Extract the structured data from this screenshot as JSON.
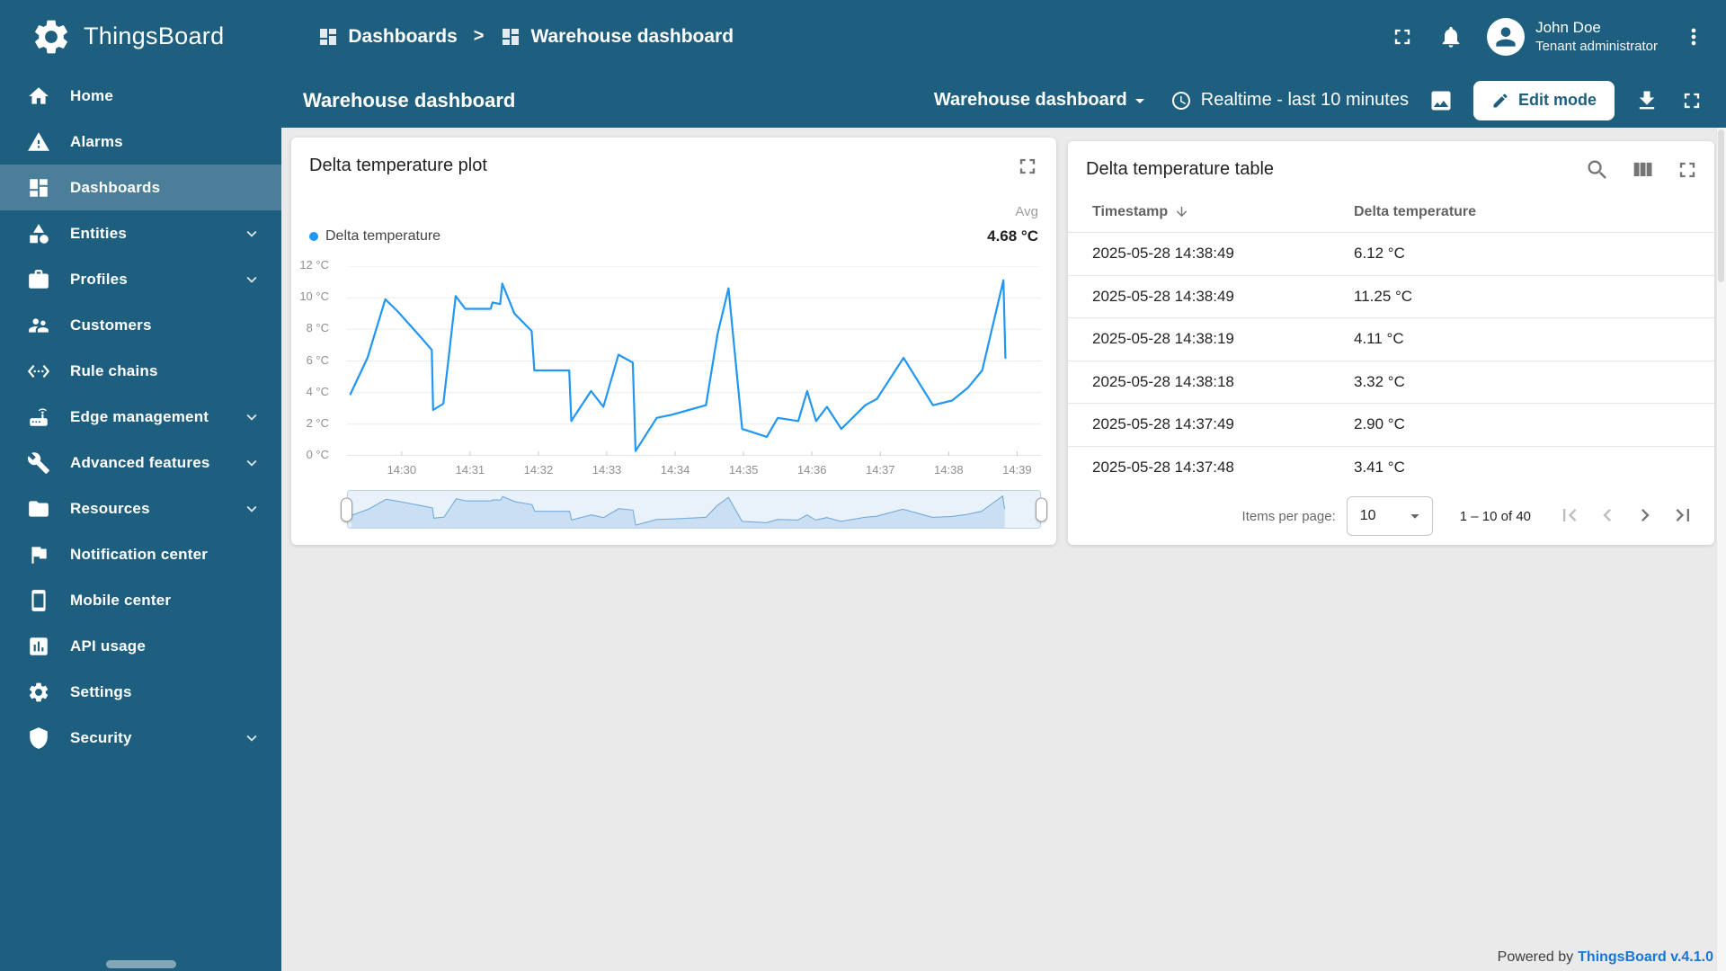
{
  "colors": {
    "primary": "#1e5f80",
    "sidebar_active": "rgba(255,255,255,0.2)",
    "chart_line": "#2196f3",
    "link_blue": "#1976d2",
    "content_bg": "#eaeaea"
  },
  "header": {
    "app_name": "ThingsBoard",
    "breadcrumb": [
      {
        "label": "Dashboards"
      },
      {
        "label": "Warehouse dashboard"
      }
    ],
    "breadcrumb_separator": ">",
    "user": {
      "name": "John Doe",
      "role": "Tenant administrator"
    }
  },
  "sidebar": {
    "items": [
      {
        "label": "Home",
        "icon": "home",
        "active": false,
        "expandable": false
      },
      {
        "label": "Alarms",
        "icon": "alarms",
        "active": false,
        "expandable": false
      },
      {
        "label": "Dashboards",
        "icon": "dashboards",
        "active": true,
        "expandable": false
      },
      {
        "label": "Entities",
        "icon": "entities",
        "active": false,
        "expandable": true
      },
      {
        "label": "Profiles",
        "icon": "profiles",
        "active": false,
        "expandable": true
      },
      {
        "label": "Customers",
        "icon": "customers",
        "active": false,
        "expandable": false
      },
      {
        "label": "Rule chains",
        "icon": "rule-chains",
        "active": false,
        "expandable": false
      },
      {
        "label": "Edge management",
        "icon": "edge-management",
        "active": false,
        "expandable": true
      },
      {
        "label": "Advanced features",
        "icon": "advanced-features",
        "active": false,
        "expandable": true
      },
      {
        "label": "Resources",
        "icon": "resources",
        "active": false,
        "expandable": true
      },
      {
        "label": "Notification center",
        "icon": "notification-center",
        "active": false,
        "expandable": false
      },
      {
        "label": "Mobile center",
        "icon": "mobile-center",
        "active": false,
        "expandable": false
      },
      {
        "label": "API usage",
        "icon": "api-usage",
        "active": false,
        "expandable": false
      },
      {
        "label": "Settings",
        "icon": "settings",
        "active": false,
        "expandable": false
      },
      {
        "label": "Security",
        "icon": "security",
        "active": false,
        "expandable": true
      }
    ]
  },
  "toolbar": {
    "title": "Warehouse dashboard",
    "state_selector": "Warehouse dashboard",
    "timewindow": "Realtime - last 10 minutes",
    "edit_button": "Edit mode"
  },
  "plot_widget": {
    "title": "Delta temperature plot",
    "agg_label": "Avg",
    "series_label": "Delta temperature",
    "agg_value": "4.68 °C"
  },
  "table_widget": {
    "title": "Delta temperature table",
    "columns": [
      "Timestamp",
      "Delta temperature"
    ],
    "rows": [
      {
        "timestamp": "2025-05-28 14:38:49",
        "value": "6.12 °C"
      },
      {
        "timestamp": "2025-05-28 14:38:49",
        "value": "11.25 °C"
      },
      {
        "timestamp": "2025-05-28 14:38:19",
        "value": "4.11 °C"
      },
      {
        "timestamp": "2025-05-28 14:38:18",
        "value": "3.32 °C"
      },
      {
        "timestamp": "2025-05-28 14:37:49",
        "value": "2.90 °C"
      },
      {
        "timestamp": "2025-05-28 14:37:48",
        "value": "3.41 °C"
      }
    ],
    "pagination": {
      "items_per_page_label": "Items per page:",
      "items_per_page": "10",
      "range": "1 – 10 of 40"
    }
  },
  "footer": {
    "powered_by": "Powered by",
    "link": "ThingsBoard v.4.1.0"
  },
  "chart_data": {
    "type": "line",
    "title": "Delta temperature plot",
    "x_unit": "minutes after 14:30",
    "y_unit": "°C",
    "xlim": [
      -0.8,
      9.35
    ],
    "ylim": [
      0,
      12
    ],
    "grid": "horizontal",
    "legend_position": "top-left",
    "avg": {
      "label": "Avg",
      "value": "4.68 °C"
    },
    "xticks": [
      {
        "value": 0,
        "label": "14:30"
      },
      {
        "value": 1,
        "label": "14:31"
      },
      {
        "value": 2,
        "label": "14:32"
      },
      {
        "value": 3,
        "label": "14:33"
      },
      {
        "value": 4,
        "label": "14:34"
      },
      {
        "value": 5,
        "label": "14:35"
      },
      {
        "value": 6,
        "label": "14:36"
      },
      {
        "value": 7,
        "label": "14:37"
      },
      {
        "value": 8,
        "label": "14:38"
      },
      {
        "value": 9,
        "label": "14:39"
      }
    ],
    "yticks": [
      {
        "value": 0,
        "label": "0 °C"
      },
      {
        "value": 2,
        "label": "2 °C"
      },
      {
        "value": 4,
        "label": "4 °C"
      },
      {
        "value": 6,
        "label": "6 °C"
      },
      {
        "value": 8,
        "label": "8 °C"
      },
      {
        "value": 10,
        "label": "10 °C"
      },
      {
        "value": 12,
        "label": "12 °C"
      }
    ],
    "series": [
      {
        "name": "Delta temperature",
        "color": "#2196f3",
        "points": [
          [
            -0.75,
            3.9
          ],
          [
            -0.5,
            6.2
          ],
          [
            -0.24,
            9.9
          ],
          [
            -0.05,
            9.1
          ],
          [
            0.3,
            7.4
          ],
          [
            0.44,
            6.7
          ],
          [
            0.46,
            2.9
          ],
          [
            0.61,
            3.3
          ],
          [
            0.79,
            10.1
          ],
          [
            0.93,
            9.3
          ],
          [
            1.3,
            9.3
          ],
          [
            1.33,
            9.7
          ],
          [
            1.44,
            9.6
          ],
          [
            1.47,
            10.9
          ],
          [
            1.65,
            9.0
          ],
          [
            1.9,
            7.9
          ],
          [
            1.94,
            5.4
          ],
          [
            2.45,
            5.4
          ],
          [
            2.48,
            2.2
          ],
          [
            2.77,
            4.1
          ],
          [
            2.95,
            3.1
          ],
          [
            3.17,
            6.4
          ],
          [
            3.38,
            5.9
          ],
          [
            3.42,
            0.3
          ],
          [
            3.73,
            2.4
          ],
          [
            3.95,
            2.6
          ],
          [
            4.45,
            3.2
          ],
          [
            4.62,
            7.7
          ],
          [
            4.78,
            10.6
          ],
          [
            4.98,
            1.7
          ],
          [
            5.34,
            1.2
          ],
          [
            5.5,
            2.4
          ],
          [
            5.8,
            2.2
          ],
          [
            5.93,
            4.1
          ],
          [
            6.06,
            2.2
          ],
          [
            6.22,
            3.1
          ],
          [
            6.43,
            1.7
          ],
          [
            6.78,
            3.2
          ],
          [
            6.95,
            3.6
          ],
          [
            7.34,
            6.2
          ],
          [
            7.77,
            3.2
          ],
          [
            8.05,
            3.5
          ],
          [
            8.28,
            4.3
          ],
          [
            8.49,
            5.4
          ],
          [
            8.8,
            11.1
          ],
          [
            8.83,
            6.2
          ]
        ]
      }
    ]
  }
}
